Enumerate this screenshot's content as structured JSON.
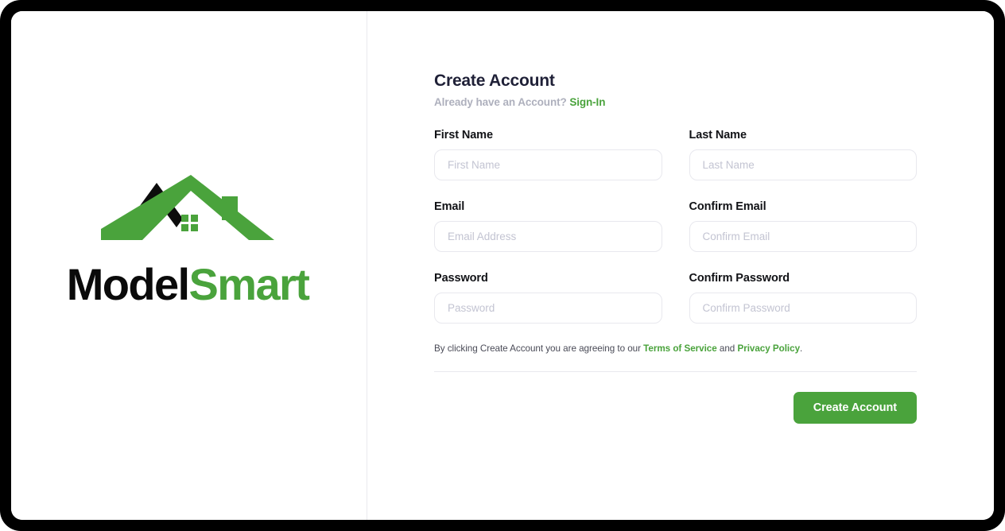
{
  "brand": {
    "logo_icon": "house-roof-logo-icon",
    "name_part_dark": "Model",
    "name_part_green": "Smart",
    "dark_color": "#0a0a0a",
    "green_color": "#4aa33c"
  },
  "form": {
    "title": "Create Account",
    "signin_prompt": "Already have an Account?",
    "signin_link": "Sign-In",
    "fields": [
      {
        "label": "First Name",
        "placeholder": "First Name",
        "value": "",
        "type": "text"
      },
      {
        "label": "Last Name",
        "placeholder": "Last Name",
        "value": "",
        "type": "text"
      },
      {
        "label": "Email",
        "placeholder": "Email Address",
        "value": "",
        "type": "email"
      },
      {
        "label": "Confirm Email",
        "placeholder": "Confirm Email",
        "value": "",
        "type": "email"
      },
      {
        "label": "Password",
        "placeholder": "Password",
        "value": "",
        "type": "password"
      },
      {
        "label": "Confirm Password",
        "placeholder": "Confirm Password",
        "value": "",
        "type": "password"
      }
    ],
    "terms": {
      "prefix": "By clicking Create Account you are agreeing to our ",
      "terms_link": "Terms of Service",
      "conjunction": " and ",
      "privacy_link": "Privacy Policy",
      "suffix": "."
    },
    "submit_label": "Create Account"
  },
  "colors": {
    "accent_green": "#4aa33c",
    "title_navy": "#1f2037",
    "muted_gray": "#aeb0bd",
    "border_gray": "#e8e8ee",
    "placeholder_gray": "#c3c4d2"
  }
}
